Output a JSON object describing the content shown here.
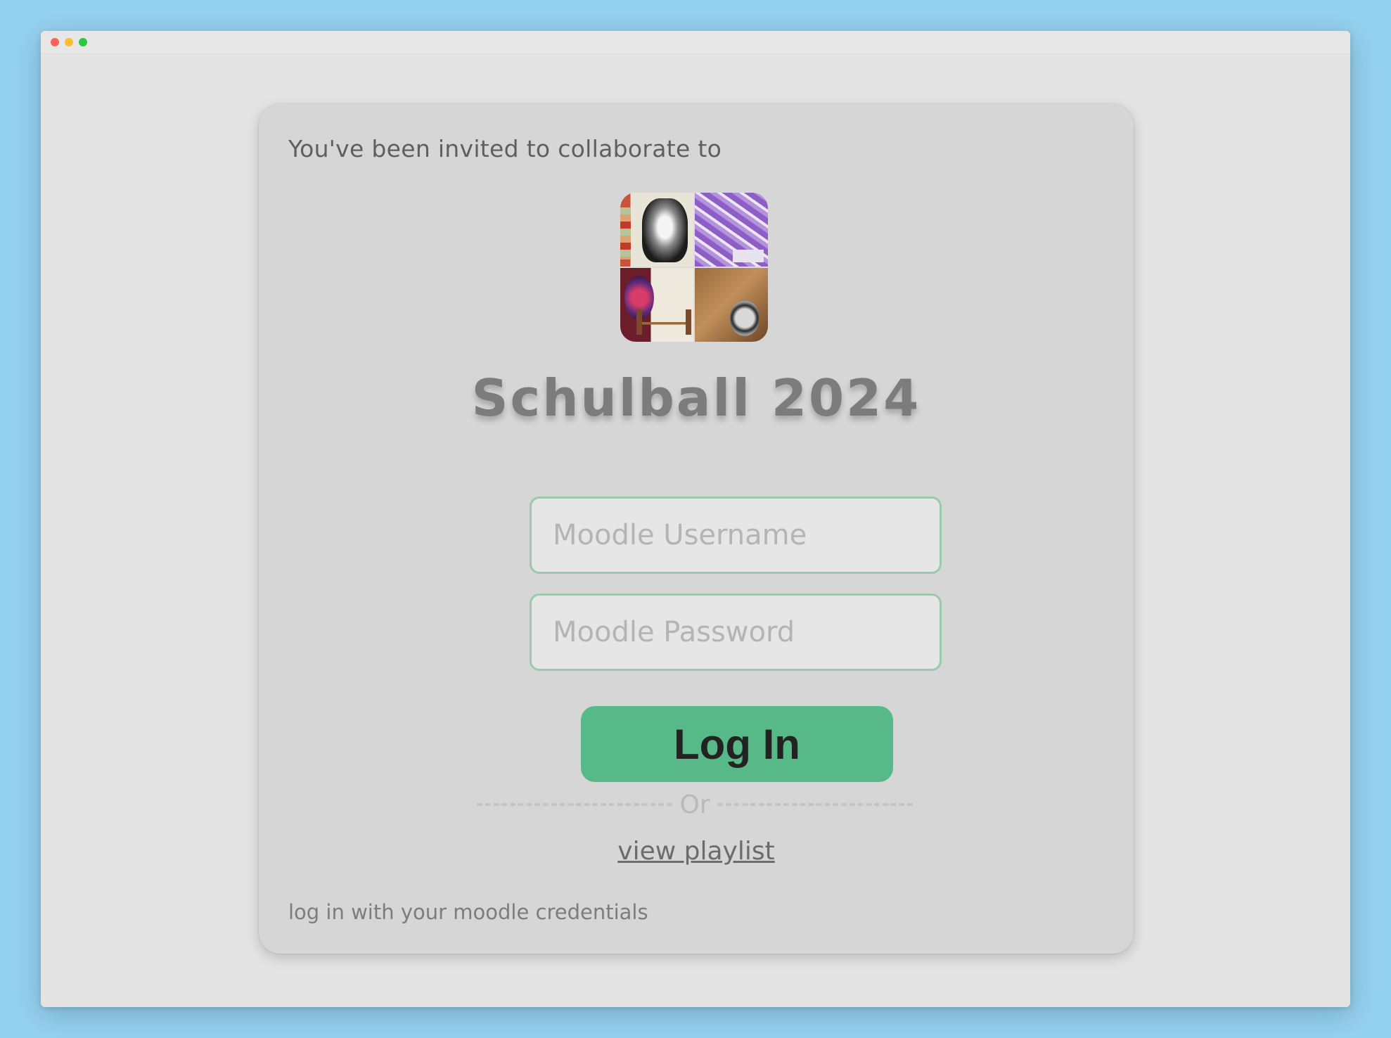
{
  "invite": {
    "text": "You've been invited to collaborate to"
  },
  "playlist": {
    "title": "Schulball 2024",
    "cover_icon": "playlist-cover-collage"
  },
  "form": {
    "username_placeholder": "Moodle Username",
    "username_value": "",
    "password_placeholder": "Moodle Password",
    "password_value": "",
    "login_label": "Log In",
    "divider_label": "Or",
    "view_link_label": "view playlist"
  },
  "footer": {
    "note": "log in with your moodle credentials"
  },
  "colors": {
    "page_background": "#94d0ef",
    "card_background": "#d6d6d6",
    "accent_green": "#56b987",
    "input_border": "#9cc9aa"
  }
}
